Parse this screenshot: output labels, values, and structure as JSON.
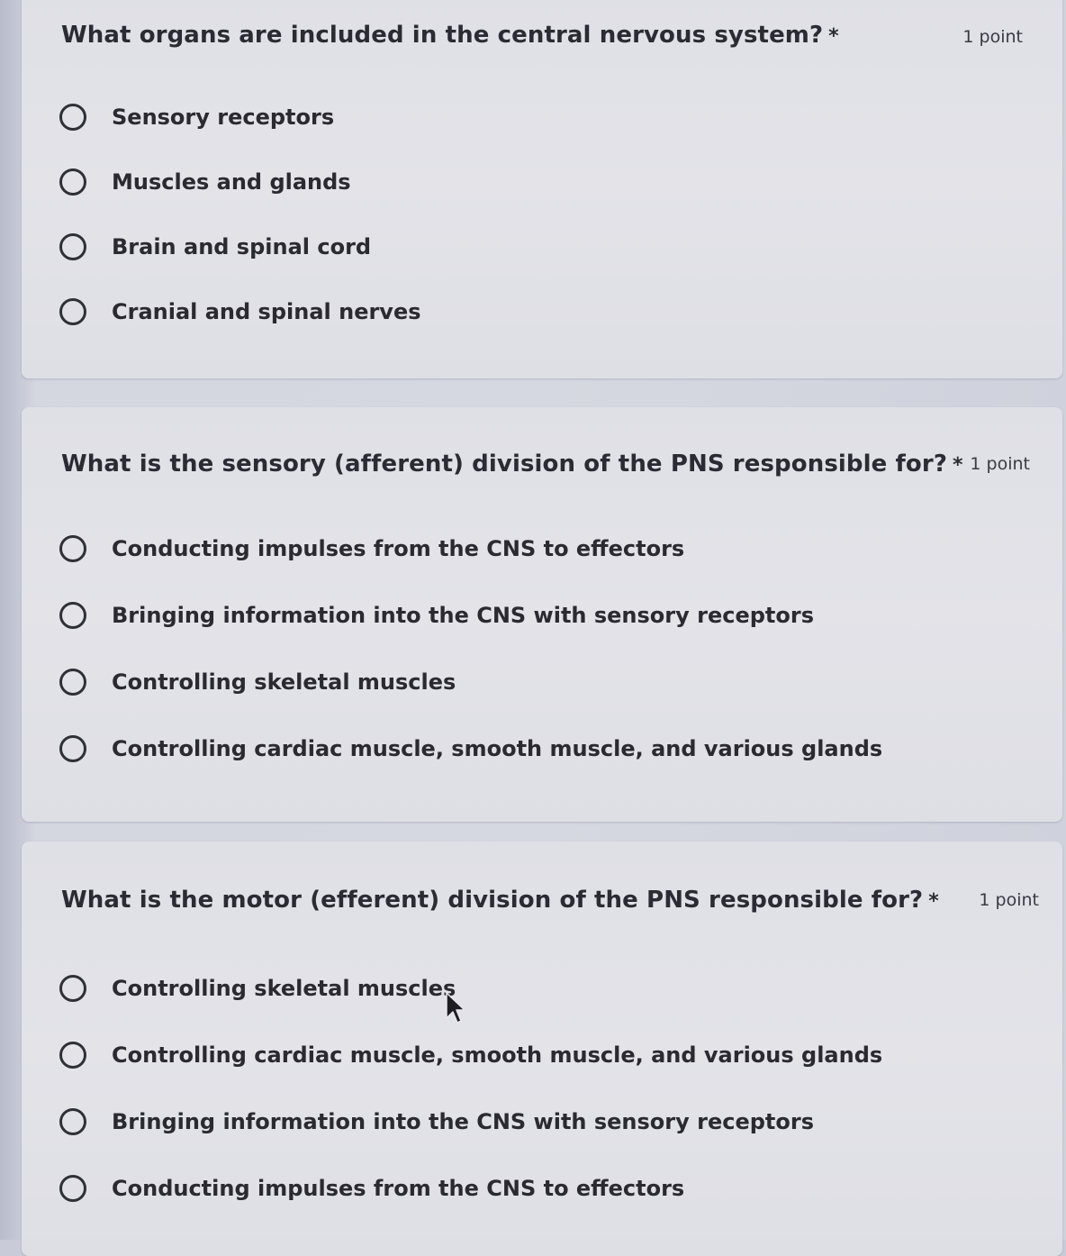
{
  "questions": [
    {
      "text": "What organs are included in the central nervous system?",
      "required_mark": "*",
      "points": "1 point",
      "options": [
        "Sensory receptors",
        "Muscles and glands",
        "Brain and spinal cord",
        "Cranial and spinal nerves"
      ]
    },
    {
      "text": "What is the sensory (afferent) division of the PNS responsible for?",
      "required_mark": "*",
      "points": "1 point",
      "options": [
        "Conducting impulses from the CNS to effectors",
        "Bringing information into the CNS with sensory receptors",
        "Controlling skeletal muscles",
        "Controlling cardiac muscle, smooth muscle, and various glands"
      ]
    },
    {
      "text": "What is the motor (efferent) division of the PNS responsible for?",
      "required_mark": "*",
      "points": "1 point",
      "options": [
        "Controlling skeletal muscles",
        "Controlling cardiac muscle, smooth muscle, and various glands",
        "Bringing information into the CNS with sensory receptors",
        "Conducting impulses from the CNS to effectors"
      ]
    }
  ],
  "colors": {
    "page_background": "#c9ccd8",
    "card_background": "#e2e3e8",
    "text": "#2b2b33",
    "radio_border": "#2f2f36"
  },
  "icons": {
    "radio": "radio-unselected-icon",
    "cursor": "mouse-pointer-icon"
  }
}
